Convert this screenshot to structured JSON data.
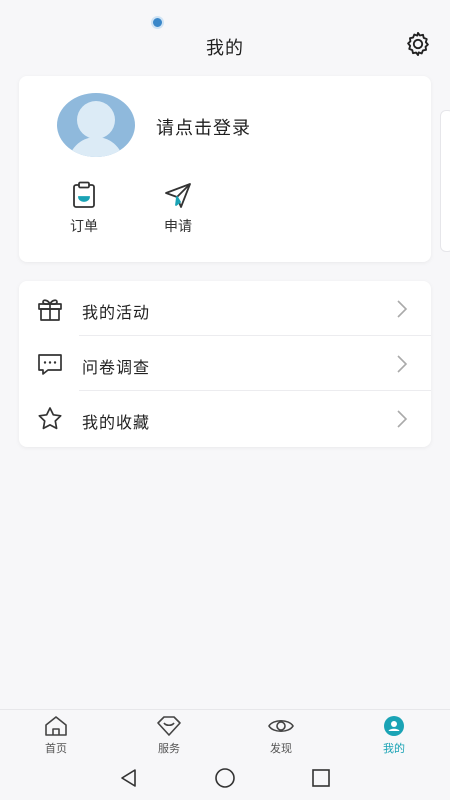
{
  "header": {
    "title": "我的",
    "settings_icon": "gear-icon"
  },
  "profile": {
    "login_prompt": "请点击登录",
    "avatar_icon": "default-avatar-icon",
    "quick_actions": [
      {
        "label": "订单",
        "icon": "order-clipboard-icon"
      },
      {
        "label": "申请",
        "icon": "paper-plane-icon"
      }
    ]
  },
  "menu": {
    "items": [
      {
        "label": "我的活动",
        "icon": "gift-icon"
      },
      {
        "label": "问卷调查",
        "icon": "chat-bubble-icon"
      },
      {
        "label": "我的收藏",
        "icon": "star-icon"
      }
    ]
  },
  "tabbar": {
    "tabs": [
      {
        "label": "首页",
        "icon": "home-icon",
        "active": false
      },
      {
        "label": "服务",
        "icon": "service-icon",
        "active": false
      },
      {
        "label": "发现",
        "icon": "eye-icon",
        "active": false
      },
      {
        "label": "我的",
        "icon": "user-icon",
        "active": true
      }
    ]
  },
  "colors": {
    "accent": "#1aa3b5",
    "avatar": "#8fb9dc",
    "background": "#f7f7f9"
  },
  "system_nav": [
    "back-icon",
    "home-circle-icon",
    "recents-icon"
  ]
}
